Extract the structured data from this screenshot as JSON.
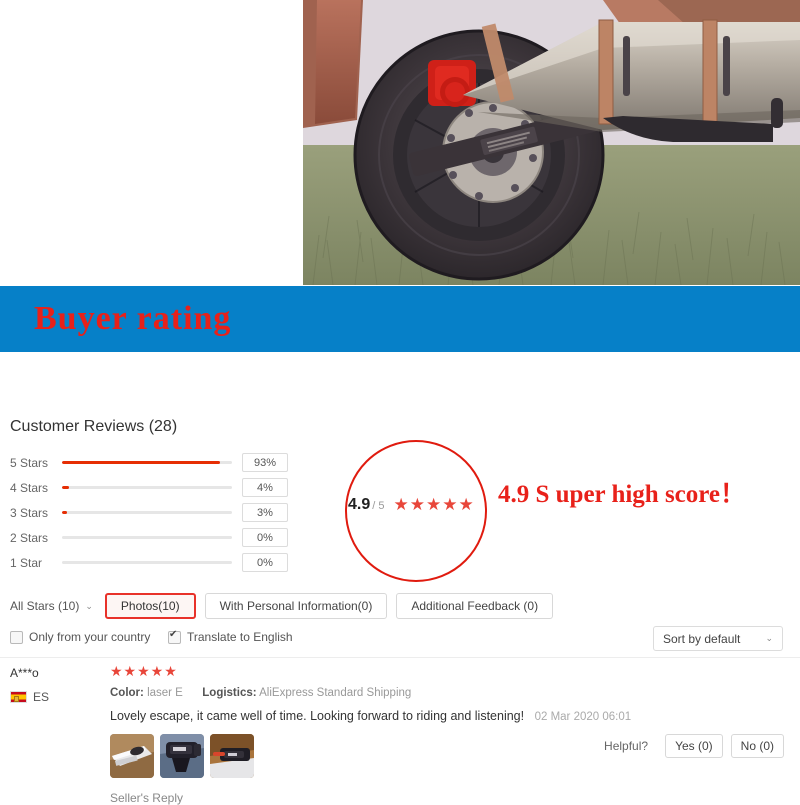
{
  "product_photo": {
    "alt": "motorcycle rear wheel with slip-on exhaust muffler on grass",
    "icon": "product-photo"
  },
  "banner": {
    "text": "Buyer rating",
    "bg_color": "#0680c8",
    "text_color": "#e8211a"
  },
  "reviews": {
    "title": "Customer Reviews (28)",
    "breakdown": [
      {
        "label": "5 Stars",
        "percent": "93%",
        "value": 93
      },
      {
        "label": "4 Stars",
        "percent": "4%",
        "value": 4
      },
      {
        "label": "3 Stars",
        "percent": "3%",
        "value": 3
      },
      {
        "label": "2 Stars",
        "percent": "0%",
        "value": 0
      },
      {
        "label": "1 Star",
        "percent": "0%",
        "value": 0
      }
    ],
    "score": {
      "value": "4.9",
      "denominator": "/ 5",
      "stars": "★★★★★",
      "caption": "4.9 S uper high score！",
      "circle_color": "#e01b0f"
    }
  },
  "filters": {
    "all_stars": {
      "label": "All Stars (10)",
      "caret": "⌄"
    },
    "buttons": [
      {
        "label": "Photos(10)",
        "active": true
      },
      {
        "label": "With Personal Information(0)",
        "active": false
      },
      {
        "label": "Additional Feedback (0)",
        "active": false
      }
    ]
  },
  "options": {
    "only_country": {
      "label": "Only from your country",
      "checked": false
    },
    "translate": {
      "label": "Translate to English",
      "checked": true
    },
    "sort": {
      "label": "Sort by default",
      "caret": "⌄"
    }
  },
  "review": {
    "reviewer": "A***o",
    "country_code": "ES",
    "stars": "★★★★★",
    "color_key": "Color:",
    "color_value": "laser E",
    "logistics_key": "Logistics:",
    "logistics_value": "AliExpress Standard Shipping",
    "text": "Lovely escape, it came well of time. Looking forward to riding and listening!",
    "date": "02 Mar 2020 06:01",
    "thumbnails": [
      "thumb-1",
      "thumb-2",
      "thumb-3"
    ],
    "sellers_reply": "Seller's Reply",
    "helpful_label": "Helpful?",
    "helpful_yes": "Yes (0)",
    "helpful_no": "No (0)"
  }
}
